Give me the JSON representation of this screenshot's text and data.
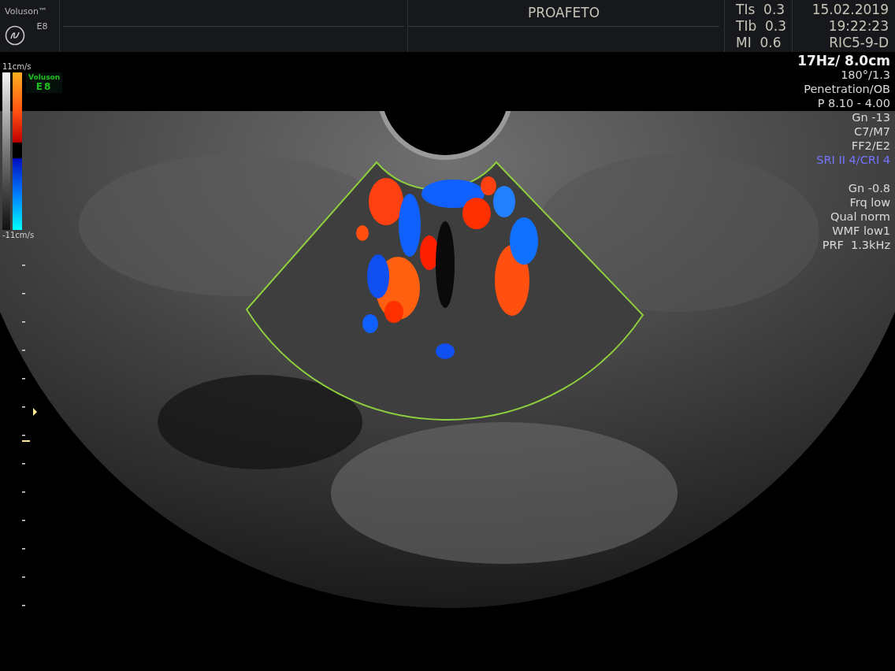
{
  "header": {
    "brand": "Voluson™",
    "model": "E8",
    "patient": "PROAFETO",
    "indices": [
      {
        "label": "TIs",
        "value": "0.3"
      },
      {
        "label": "TIb",
        "value": "0.3"
      },
      {
        "label": "MI",
        "value": "0.6"
      }
    ],
    "date": "15.02.2019",
    "time": "19:22:23",
    "probe": "RIC5-9-D"
  },
  "color_scale": {
    "top": "11cm/s",
    "bottom": "-11cm/s",
    "badge_brand": "Voluson",
    "badge_model": "E8"
  },
  "parameters": [
    {
      "text": "17Hz/ 8.0cm",
      "kind": "heading"
    },
    {
      "text": "180°/1.3",
      "kind": "normal"
    },
    {
      "text": "Penetration/OB",
      "kind": "normal"
    },
    {
      "text": "P 8.10 - 4.00",
      "kind": "normal"
    },
    {
      "text": "Gn -13",
      "kind": "normal"
    },
    {
      "text": "C7/M7",
      "kind": "normal"
    },
    {
      "text": "FF2/E2",
      "kind": "normal"
    },
    {
      "text": "SRI II 4/CRI 4",
      "kind": "highlight"
    },
    {
      "text": "Gn -0.8",
      "kind": "section"
    },
    {
      "text": "Frq low",
      "kind": "normal"
    },
    {
      "text": "Qual norm",
      "kind": "normal"
    },
    {
      "text": "WMF low1",
      "kind": "normal"
    },
    {
      "text": "PRF  1.3kHz",
      "kind": "normal"
    }
  ]
}
